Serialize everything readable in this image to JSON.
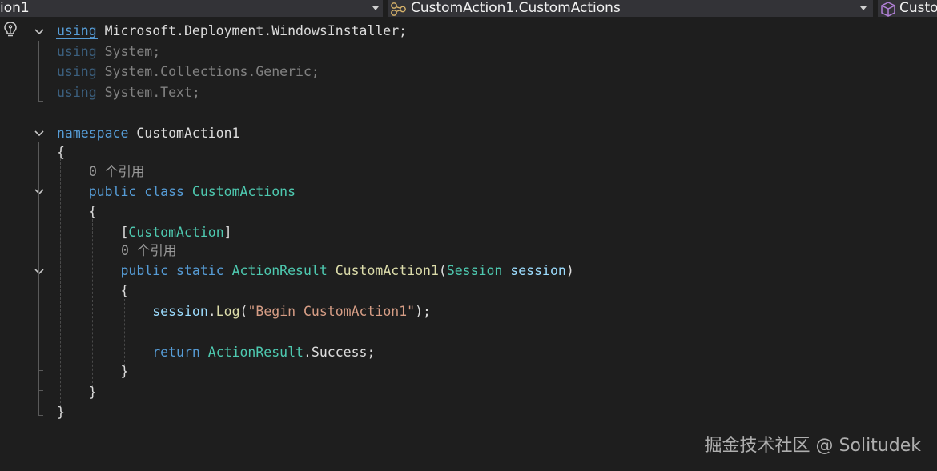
{
  "navbar": {
    "project_combo": "ion1",
    "type_combo": "CustomAction1.CustomActions",
    "member_combo": "Custo"
  },
  "icons": {
    "project_combo_arrow": "chevron-down-icon",
    "type_icon": "class-type-icon",
    "type_combo_arrow": "chevron-down-icon",
    "member_icon": "member-cube-icon",
    "quick_actions": "lightbulb-icon",
    "fold_toggles": "chevron-down-icon"
  },
  "code": {
    "line1": {
      "kw": "using",
      "ns": "Microsoft.Deployment.WindowsInstaller;"
    },
    "line2": {
      "kw": "using",
      "ns": "System;"
    },
    "line3": {
      "kw": "using",
      "ns": "System.Collections.Generic;"
    },
    "line4": {
      "kw": "using",
      "ns": "System.Text;"
    },
    "line6": {
      "kw": "namespace",
      "name": "CustomAction1"
    },
    "line7": {
      "brace": "{"
    },
    "lens1": "0 个引用",
    "line8": {
      "kw1": "public",
      "kw2": "class",
      "name": "CustomActions"
    },
    "line9": {
      "brace": "{"
    },
    "line10": {
      "open": "[",
      "attr": "CustomAction",
      "close": "]"
    },
    "lens2": "0 个引用",
    "line11": {
      "kw1": "public",
      "kw2": "static",
      "ret": "ActionResult",
      "method": "CustomAction1",
      "open": "(",
      "ptype": "Session",
      "pname": "session",
      "close": ")"
    },
    "line12": {
      "brace": "{"
    },
    "line13": {
      "obj": "session",
      "dot": ".",
      "call": "Log",
      "open": "(",
      "str": "\"Begin CustomAction1\"",
      "close": ");"
    },
    "line15": {
      "kw": "return",
      "type": "ActionResult",
      "rest": ".Success;"
    },
    "line16": {
      "brace": "}"
    },
    "line17": {
      "brace": "}"
    },
    "line18": {
      "brace": "}"
    }
  },
  "watermark": "掘金技术社区 @ Solitudek",
  "colors": {
    "background": "#1e1e1e",
    "keyword": "#569cd6",
    "type": "#4ec9b0",
    "method": "#dcdcaa",
    "string": "#d69d85",
    "text": "#dcdcdc",
    "codelens": "#999999",
    "combo_bg": "#333337"
  }
}
